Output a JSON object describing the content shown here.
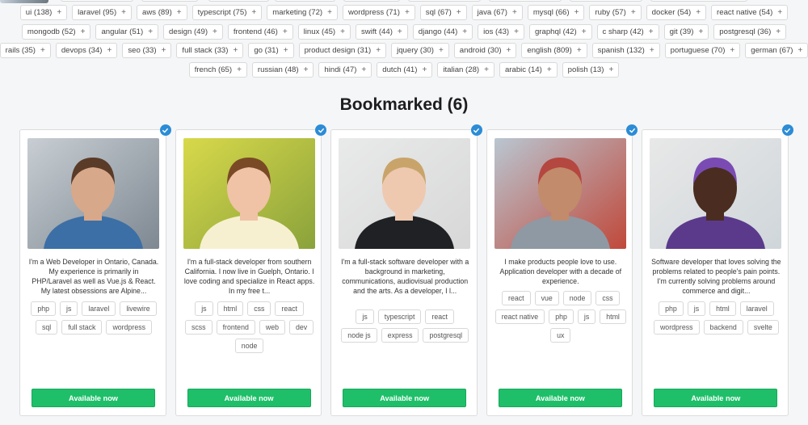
{
  "tag_rows": [
    [
      "ui (138)",
      "laravel (95)",
      "aws (89)",
      "typescript (75)",
      "marketing (72)",
      "wordpress (71)",
      "sql (67)",
      "java (67)",
      "mysql (66)",
      "ruby (57)",
      "docker (54)",
      "react native (54)"
    ],
    [
      "mongodb (52)",
      "angular (51)",
      "design (49)",
      "frontend (46)",
      "linux (45)",
      "swift (44)",
      "django (44)",
      "ios (43)",
      "graphql (42)",
      "c sharp (42)",
      "git (39)",
      "postgresql (36)"
    ],
    [
      "rails (35)",
      "devops (34)",
      "seo (33)",
      "full stack (33)",
      "go (31)",
      "product design (31)",
      "jquery (30)",
      "android (30)",
      "english (809)",
      "spanish (132)",
      "portuguese (70)",
      "german (67)"
    ],
    [
      "french (65)",
      "russian (48)",
      "hindi (47)",
      "dutch (41)",
      "italian (28)",
      "arabic (14)",
      "polish (13)"
    ]
  ],
  "tag_add_symbol": "+",
  "section_title": "Bookmarked (6)",
  "cards": [
    {
      "bio": "I'm a Web Developer in Ontario, Canada. My experience is primarily in PHP/Laravel as well as Vue.js & React. My latest obsessions are Alpine...",
      "skills": [
        "php",
        "js",
        "laravel",
        "livewire",
        "sql",
        "full stack",
        "wordpress"
      ],
      "button": "Available now",
      "photo_colors": [
        "#c8ced3",
        "#7e8892",
        "#3c6fa5",
        "#d8a88a",
        "#5a3b28"
      ]
    },
    {
      "bio": "I'm a full-stack developer from southern California. I now live in Guelph, Ontario. I love coding and specialize in React apps. In my free t...",
      "skills": [
        "js",
        "html",
        "css",
        "react",
        "scss",
        "frontend",
        "web",
        "dev",
        "node"
      ],
      "button": "Available now",
      "photo_colors": [
        "#d8d94a",
        "#8aa23b",
        "#f7f0d0",
        "#f0c2a6",
        "#7a4a26"
      ]
    },
    {
      "bio": "I'm a full-stack software developer with a background in marketing, communications, audiovisual production and the arts. As a developer, I l...",
      "skills": [
        "js",
        "typescript",
        "react",
        "node js",
        "express",
        "postgresql"
      ],
      "button": "Available now",
      "photo_colors": [
        "#e9eaea",
        "#d7d7d7",
        "#1f2124",
        "#efc8b0",
        "#c9a46a"
      ]
    },
    {
      "bio": "I make products people love to use. Application developer with a decade of experience.",
      "skills": [
        "react",
        "vue",
        "node",
        "css",
        "react native",
        "php",
        "js",
        "html",
        "ux"
      ],
      "button": "Available now",
      "photo_colors": [
        "#b9c6d1",
        "#c0483a",
        "#8f99a3",
        "#c28b6b",
        "#b4473f"
      ]
    },
    {
      "bio": "Software developer that loves solving the problems related to people's pain points. I'm currently solving problems around commerce and digit...",
      "skills": [
        "php",
        "js",
        "html",
        "laravel",
        "wordpress",
        "backend",
        "svelte"
      ],
      "button": "Available now",
      "photo_colors": [
        "#e8e8e8",
        "#cfd6da",
        "#5b3a8c",
        "#4a2d20",
        "#7b4bb4"
      ]
    }
  ],
  "colors": {
    "accent_green": "#1fbf6a",
    "check_blue": "#2c8cd6",
    "page_bg": "#f5f6f7"
  },
  "icons": {
    "bookmark_check": "checkmark-badge-icon"
  }
}
